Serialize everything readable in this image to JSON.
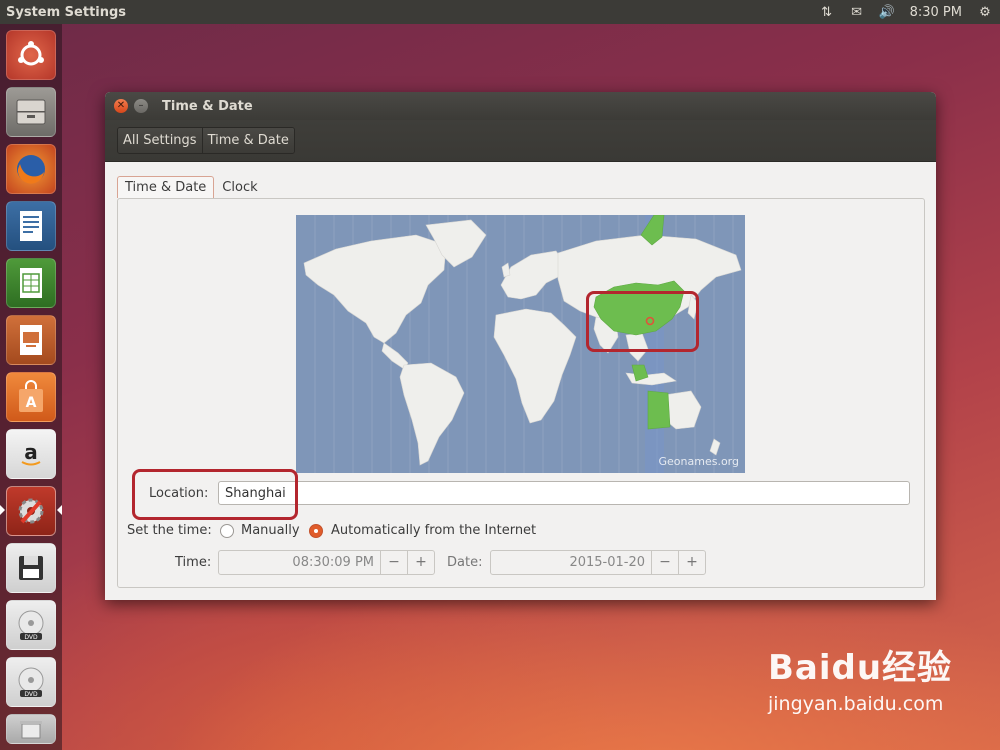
{
  "panel": {
    "title": "System Settings",
    "time": "8:30 PM"
  },
  "window": {
    "title": "Time & Date",
    "breadcrumbs": [
      "All Settings",
      "Time & Date"
    ],
    "tabs": [
      "Time & Date",
      "Clock"
    ]
  },
  "map": {
    "credit": "Geonames.org",
    "selected_region": "China"
  },
  "location": {
    "label": "Location:",
    "value": "Shanghai"
  },
  "set_time": {
    "label": "Set the time:",
    "options": [
      "Manually",
      "Automatically from the Internet"
    ],
    "selected": "Automatically from the Internet"
  },
  "time": {
    "label": "Time:",
    "value": "08:30:09 PM"
  },
  "date": {
    "label": "Date:",
    "value": "2015-01-20"
  },
  "buttons": {
    "minus": "−",
    "plus": "+"
  },
  "colors": {
    "accent": "#e05c2a",
    "highlight": "#b3262e",
    "selected_zone": "#6dbd4f"
  },
  "watermark": {
    "logo": "Baidu经验",
    "url": "jingyan.baidu.com"
  }
}
